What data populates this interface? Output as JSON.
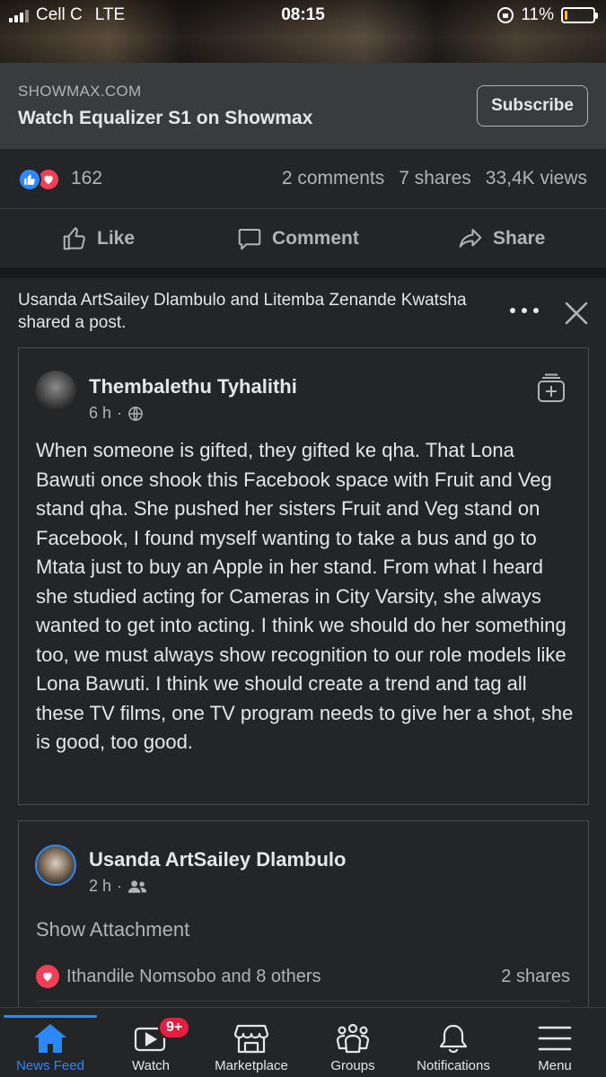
{
  "status_bar": {
    "carrier": "Cell C",
    "network": "LTE",
    "time": "08:15",
    "battery": "11%",
    "battery_level": 0.11
  },
  "link_preview": {
    "domain": "SHOWMAX.COM",
    "title": "Watch Equalizer S1 on Showmax",
    "button_label": "Subscribe"
  },
  "reactions": {
    "count": "162",
    "comments": "2 comments",
    "shares": "7 shares",
    "views": "33,4K views"
  },
  "actions": {
    "like": "Like",
    "comment": "Comment",
    "share": "Share"
  },
  "shared_post": {
    "header": "Usanda ArtSailey Dlambulo and Litemba Zenande Kwatsha shared a post.",
    "original": {
      "author": "Thembalethu Tyhalithi",
      "time": "6 h",
      "separator": "·",
      "privacy_icon": "globe-icon",
      "text": "When someone is gifted, they gifted ke qha. That Lona Bawuti once shook this Facebook space with Fruit and Veg stand qha. She pushed her sisters Fruit and Veg stand on Facebook, I found myself wanting to take a bus and go to Mtata just to buy an Apple in her stand. From what I heard she studied acting for Cameras in City Varsity, she always wanted to get into acting. I think we should do her something too, we must always show recognition to our role models like Lona Bawuti. I think we should create a trend and tag all these TV films, one TV program needs to give her a shot, she is good, too good."
    },
    "share_entry": {
      "author": "Usanda ArtSailey Dlambulo",
      "time": "2 h",
      "separator": "·",
      "privacy_icon": "friends-icon",
      "attachment_label": "Show Attachment",
      "reactions_text": "Ithandile Nomsobo and 8 others",
      "shares_text": "2 shares"
    }
  },
  "bottom_nav": {
    "items": [
      {
        "label": "News Feed",
        "icon": "home-icon",
        "active": true
      },
      {
        "label": "Watch",
        "icon": "video-icon",
        "badge": "9+"
      },
      {
        "label": "Marketplace",
        "icon": "shop-icon"
      },
      {
        "label": "Groups",
        "icon": "groups-icon"
      },
      {
        "label": "Notifications",
        "icon": "bell-icon"
      },
      {
        "label": "Menu",
        "icon": "hamburger-icon"
      }
    ]
  },
  "colors": {
    "accent": "#2d88ff",
    "love": "#f33e58",
    "badge": "#e41e3f",
    "background": "#18191a",
    "card": "#242526"
  }
}
